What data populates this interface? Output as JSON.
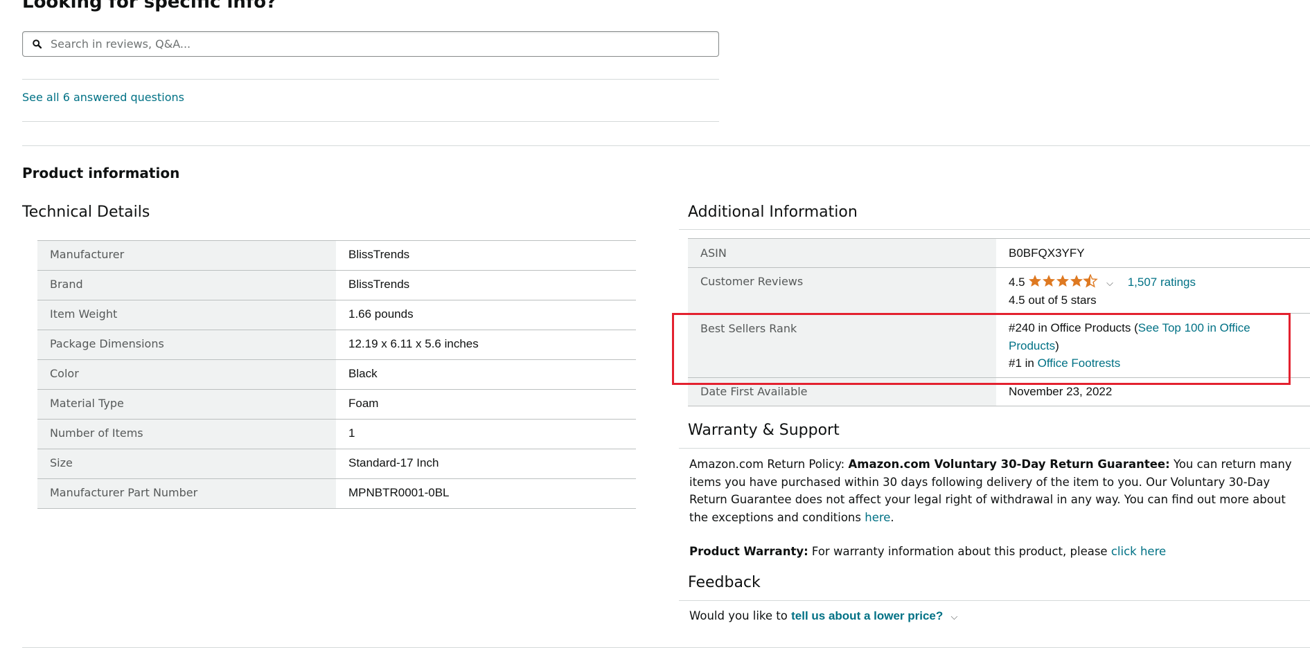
{
  "qa": {
    "heading": "Looking for specific info?",
    "search_placeholder": "Search in reviews, Q&A...",
    "see_all": "See all 6 answered questions"
  },
  "product_info": {
    "title": "Product information",
    "technical_details": {
      "title": "Technical Details",
      "rows": [
        {
          "key": "Manufacturer",
          "value": "BlissTrends"
        },
        {
          "key": "Brand",
          "value": "BlissTrends"
        },
        {
          "key": "Item Weight",
          "value": "1.66 pounds"
        },
        {
          "key": "Package Dimensions",
          "value": "12.19 x 6.11 x 5.6 inches"
        },
        {
          "key": "Color",
          "value": "Black"
        },
        {
          "key": "Material Type",
          "value": "Foam"
        },
        {
          "key": "Number of Items",
          "value": "1"
        },
        {
          "key": "Size",
          "value": "Standard-17 Inch"
        },
        {
          "key": "Manufacturer Part Number",
          "value": "MPNBTR0001-0BL"
        }
      ]
    },
    "additional_information": {
      "title": "Additional Information",
      "asin_label": "ASIN",
      "asin_value": "B0BFQX3YFY",
      "reviews_label": "Customer Reviews",
      "rating_value": "4.5",
      "rating_stars": 4.5,
      "ratings_link": "1,507 ratings",
      "rating_text": "4.5 out of 5 stars",
      "rank_label": "Best Sellers Rank",
      "rank_1_prefix": "#240 in Office Products (",
      "rank_1_link": "See Top 100 in Office Products",
      "rank_1_suffix": ")",
      "rank_2_prefix": "#1 in ",
      "rank_2_link": "Office Footrests",
      "date_label": "Date First Available",
      "date_value": "November 23, 2022"
    },
    "warranty": {
      "title": "Warranty & Support",
      "policy_prefix": "Amazon.com Return Policy: ",
      "policy_bold": "Amazon.com Voluntary 30-Day Return Guarantee:",
      "policy_text": " You can return many items you have purchased within 30 days following delivery of the item to you. Our Voluntary 30-Day Return Guarantee does not affect your legal right of withdrawal in any way. You can find out more about the exceptions and conditions ",
      "policy_link": "here",
      "policy_end": ".",
      "warranty_bold": "Product Warranty:",
      "warranty_text": " For warranty information about this product, please ",
      "warranty_link": "click here"
    },
    "feedback": {
      "title": "Feedback",
      "prefix": "Would you like to ",
      "link": "tell us about a lower price?"
    }
  },
  "colors": {
    "link": "#007185",
    "star": "#de7921",
    "highlight": "#e3212f"
  }
}
